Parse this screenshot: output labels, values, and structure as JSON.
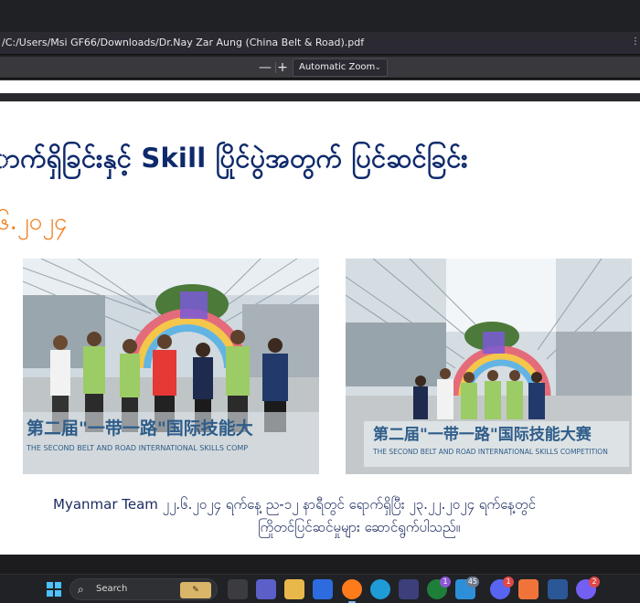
{
  "browser": {
    "url": "/C:/Users/Msi GF66/Downloads/Dr.Nay Zar Aung (China Belt & Road).pdf"
  },
  "pdf_toolbar": {
    "zoom_out": "—",
    "zoom_in": "+",
    "zoom_level": "Automatic Zoom"
  },
  "document": {
    "heading": "ာက်ရှိခြင်းနှင့် Skill ပြိုင်ပွဲအတွက် ပြင်ဆင်ခြင်း",
    "date_fragment": "၆.၂၀၂၄",
    "photo1": {
      "banner_chinese": "第二届\"一带一路\"国际技能大",
      "banner_english": "THE SECOND BELT AND ROAD INTERNATIONAL SKILLS COMP"
    },
    "photo2": {
      "banner_chinese": "第二届\"一带一路\"国际技能大赛",
      "banner_english": "THE SECOND BELT AND ROAD INTERNATIONAL SKILLS COMPETITION"
    },
    "caption_line1": "Myanmar Team ၂၂.၆.၂၀၂၄ ရက်နေ့ ည-၁၂ နာရီတွင် ရောက်ရှိပြီး ၂၃.၂၂.၂၀၂၄ ရက်နေ့တွင်",
    "caption_line2": "ကြိုတင်ပြင်ဆင်မှုများ ဆောင်ရွက်ပါသည်။"
  },
  "taskbar": {
    "search_label": "Search",
    "badges": {
      "xbox": "1",
      "ms_store_app": "45",
      "discord": "1",
      "viber": "2"
    }
  }
}
